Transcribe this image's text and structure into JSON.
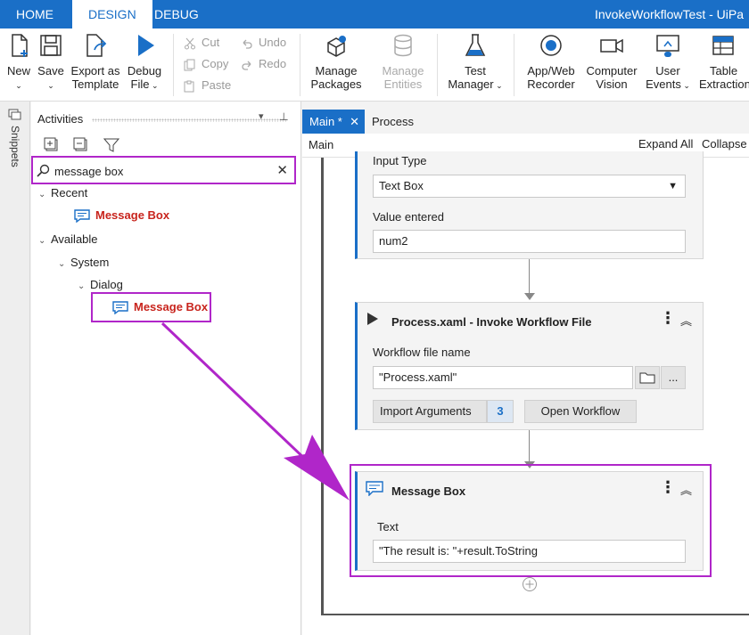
{
  "top_tabs": [
    "HOME",
    "DESIGN",
    "DEBUG"
  ],
  "window_title": "InvokeWorkflowTest - UiPa",
  "ribbon": {
    "new": "New",
    "save": "Save",
    "export_line1": "Export as",
    "export_line2": "Template",
    "debug_line1": "Debug",
    "debug_line2": "File",
    "cut": "Cut",
    "copy": "Copy",
    "paste": "Paste",
    "undo": "Undo",
    "redo": "Redo",
    "manage_packages_1": "Manage",
    "manage_packages_2": "Packages",
    "manage_entities_1": "Manage",
    "manage_entities_2": "Entities",
    "test_manager_1": "Test",
    "test_manager_2": "Manager",
    "recorder_1": "App/Web",
    "recorder_2": "Recorder",
    "cv_1": "Computer",
    "cv_2": "Vision",
    "user_events_1": "User",
    "user_events_2": "Events",
    "table_1": "Table",
    "table_2": "Extraction"
  },
  "sidebar_strip_label": "Snippets",
  "activities": {
    "title": "Activities",
    "search_value": "message box",
    "tree": {
      "recent": "Recent",
      "recent_item": "Message Box",
      "available": "Available",
      "system": "System",
      "dialog": "Dialog",
      "dialog_item": "Message Box"
    }
  },
  "doc_tabs": {
    "main": "Main *",
    "process": "Process"
  },
  "breadcrumb": {
    "path": "Main",
    "expand_all": "Expand All",
    "collapse_all": "Collapse A"
  },
  "input_card": {
    "input_type_label": "Input Type",
    "input_type_value": "Text Box",
    "value_label": "Value entered",
    "value": "num2"
  },
  "invoke_card": {
    "title": "Process.xaml - Invoke Workflow File",
    "file_label": "Workflow file name",
    "file_value": "\"Process.xaml\"",
    "browse": "...",
    "import_args": "Import Arguments",
    "import_count": "3",
    "open_workflow": "Open Workflow"
  },
  "msgbox_card": {
    "title": "Message Box",
    "text_label": "Text",
    "text_value": "\"The result is: \"+result.ToString"
  },
  "colors": {
    "accent": "#1a6fc7",
    "highlight": "#b026c9",
    "activity_red": "#c8241d"
  }
}
